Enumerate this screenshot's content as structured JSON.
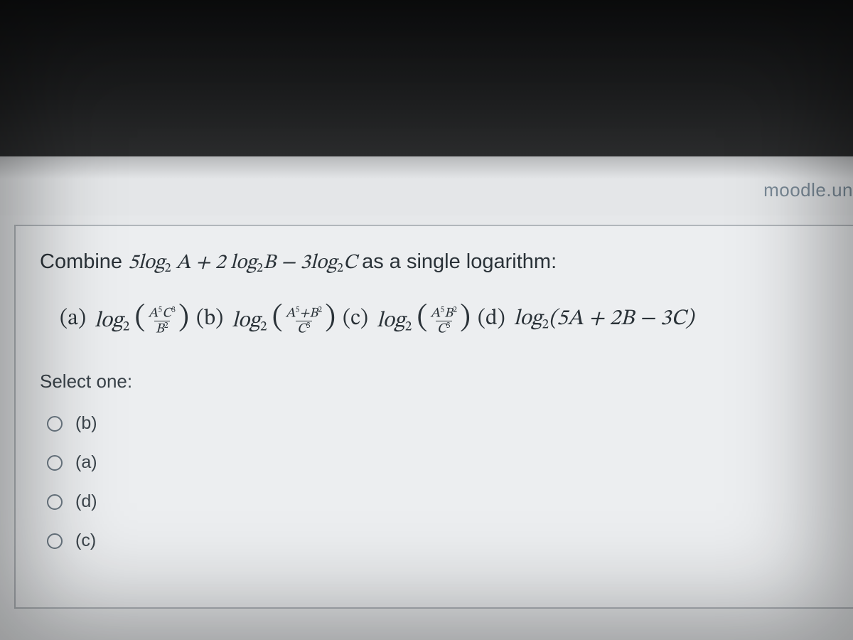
{
  "url_fragment": "moodle.un",
  "question": {
    "prompt_prefix": "Combine ",
    "expression_parts": {
      "t1_coef": "5",
      "t1_log": "log",
      "t1_base": "2",
      "t1_arg": " A",
      "plus": " + ",
      "t2_coef": "2 ",
      "t2_log": "log",
      "t2_base": "2",
      "t2_arg": "B",
      "minus": " − ",
      "t3_coef": "3",
      "t3_log": "log",
      "t3_base": "2",
      "t3_arg": "C"
    },
    "prompt_suffix": " as a single logarithm:"
  },
  "choices": {
    "a": {
      "label": "(a)",
      "log": "log",
      "base": "2",
      "num": {
        "A": "A",
        "Aexp": "5",
        "C": "C",
        "Cexp": "3"
      },
      "den": {
        "B": "B",
        "Bexp": "2"
      }
    },
    "b": {
      "label": "(b)",
      "log": "log",
      "base": "2",
      "num": {
        "A": "A",
        "Aexp": "5",
        "plus": "+",
        "B": "B",
        "Bexp": "2"
      },
      "den": {
        "C": "C",
        "Cexp": "3"
      }
    },
    "c": {
      "label": "(c)",
      "log": "log",
      "base": "2",
      "num": {
        "A": "A",
        "Aexp": "5",
        "B": "B",
        "Bexp": "2"
      },
      "den": {
        "C": "C",
        "Cexp": "3"
      }
    },
    "d": {
      "label": "(d)",
      "log": "log",
      "base": "2",
      "arg": "(5A + 2B − 3C)"
    }
  },
  "select_label": "Select one:",
  "options": [
    {
      "label": "(b)"
    },
    {
      "label": "(a)"
    },
    {
      "label": "(d)"
    },
    {
      "label": "(c)"
    }
  ]
}
